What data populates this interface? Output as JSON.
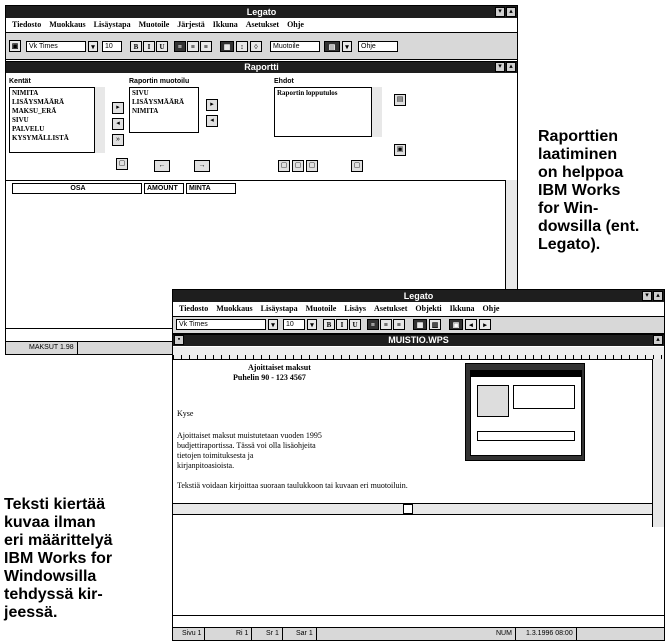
{
  "win1": {
    "title": "Legato",
    "menu": [
      "Tiedosto",
      "Muokkaus",
      "Lisäystapa",
      "Muotoile",
      "Järjestä",
      "Ikkuna",
      "Asetukset",
      "Ohje"
    ],
    "menu_extra": "Ohje",
    "toolbar": {
      "font": "Vk Times",
      "size": "10",
      "right_label": "Muotoile"
    },
    "subwindow_title": "Raportti",
    "fields_label": "Kentät",
    "fields": [
      "NIMITA",
      "LISÄYSMÄÄRÄ",
      "MAKSU_ERÄ",
      "SIVU",
      "PALVELU",
      "KYSYMÄLLISTÄ"
    ],
    "selected_label": "Raportin muotoilu",
    "selected": [
      "SIVU",
      "LISÄYSMÄÄRÄ",
      "NIMITA"
    ],
    "filter_label": "Ehdot",
    "filter_value": "Raportin lopputulos",
    "grid_headers": [
      "OSA",
      "AMOUNT",
      "MINTA"
    ],
    "status": "MAKSUT 1.98"
  },
  "win2": {
    "title": "Legato",
    "menu": [
      "Tiedosto",
      "Muokkaus",
      "Lisäystapa",
      "Muotoile",
      "Lisäys",
      "Asetukset",
      "Objekti",
      "Ikkuna",
      "Ohje"
    ],
    "toolbar": {
      "font": "Vk Times",
      "size": "10"
    },
    "doc_title": "MUISTIO.WPS",
    "doc_heading": "Ajoittaiset maksut",
    "doc_subheading": "Puhelin 90 - 123 4567",
    "doc_lines": [
      "Kyse",
      "Ajoittaiset maksut muistutetaan vuoden 1995",
      "budjettiraportissa. Tässä voi olla lisäohjeita",
      "tietojen toimituksesta ja",
      "kirjanpitoasioista."
    ],
    "doc_line2": "Tekstiä voidaan kirjoittaa suoraan taulukkoon tai kuvaan eri muotoiluin.",
    "status": [
      "Sivu 1",
      "Ri 1",
      "Sr 1",
      "Sar 1",
      "NUM",
      "1.3.1996 08:00"
    ]
  },
  "captions": {
    "right": "Raporttien laatiminen on helppoa IBM Works for Windowsilla (ent. Legato).",
    "right_lines": [
      "Raporttien",
      "laatiminen",
      "on helppoa",
      "IBM Works",
      "for Win-",
      "dowsilla (ent.",
      "Legato)."
    ],
    "left_lines": [
      "Teksti kiertää",
      "kuvaa ilman",
      "eri määrittelyä",
      "IBM Works for",
      "Windowsilla",
      "tehdyssä kir-",
      "jeessä."
    ]
  }
}
